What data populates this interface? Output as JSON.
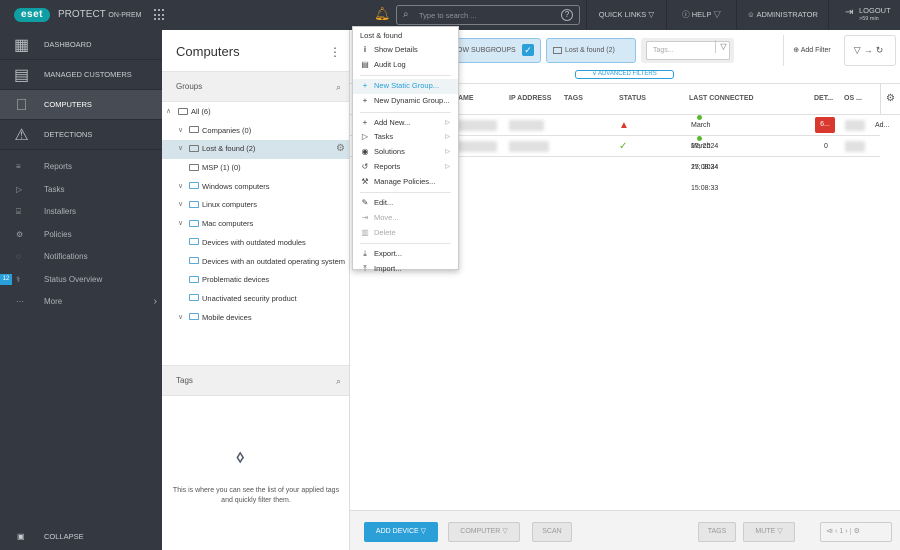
{
  "topbar": {
    "logo": "eset",
    "product": "PROTECT",
    "product_suffix": "ON-PREM",
    "search_placeholder": "Type to search ...",
    "quick_links": "QUICK LINKS",
    "help": "HELP",
    "user": "ADMINISTRATOR",
    "logout": "LOGOUT",
    "logout_timer": ">59 min"
  },
  "sidebar": {
    "main_items": [
      {
        "label": "DASHBOARD",
        "icon": "dashboard-icon"
      },
      {
        "label": "MANAGED CUSTOMERS",
        "icon": "building-icon"
      },
      {
        "label": "COMPUTERS",
        "icon": "computers-icon",
        "active": true
      },
      {
        "label": "DETECTIONS",
        "icon": "warning-icon"
      }
    ],
    "sub_items": [
      {
        "label": "Reports"
      },
      {
        "label": "Tasks"
      },
      {
        "label": "Installers"
      },
      {
        "label": "Policies"
      },
      {
        "label": "Notifications"
      },
      {
        "label": "Status Overview",
        "badge": "12"
      },
      {
        "label": "More"
      }
    ],
    "collapse": "COLLAPSE"
  },
  "groups_panel": {
    "title": "Computers",
    "groups_header": "Groups",
    "tree": [
      {
        "label": "All (6)",
        "level": 0,
        "arrow": "up"
      },
      {
        "label": "Companies (0)",
        "level": 1,
        "arrow": "down"
      },
      {
        "label": "Lost & found (2)",
        "level": 1,
        "arrow": "down",
        "selected": true
      },
      {
        "label": "MSP (1) (0)",
        "level": 2
      },
      {
        "label": "Windows computers",
        "level": 1,
        "arrow": "down"
      },
      {
        "label": "Linux computers",
        "level": 1,
        "arrow": "down"
      },
      {
        "label": "Mac computers",
        "level": 1,
        "arrow": "down"
      },
      {
        "label": "Devices with outdated modules",
        "level": 2
      },
      {
        "label": "Devices with an outdated operating system",
        "level": 2
      },
      {
        "label": "Problematic devices",
        "level": 2
      },
      {
        "label": "Unactivated security product",
        "level": 2
      },
      {
        "label": "Mobile devices",
        "level": 1,
        "arrow": "down"
      }
    ],
    "tags_header": "Tags",
    "tags_empty": "This is where you can see the list of your applied tags and quickly filter them."
  },
  "filters": {
    "show_subgroups": "OW SUBGROUPS",
    "group_chip": "Lost & found  (2)",
    "tags_placeholder": "Tags...",
    "add_filter": "Add Filter",
    "advanced_filters": "ADVANCED FILTERS"
  },
  "table": {
    "columns": [
      "AME",
      "IP ADDRESS",
      "TAGS",
      "STATUS",
      "LAST CONNECTED",
      "DET...",
      "OS ..."
    ],
    "rows": [
      {
        "status": "warning",
        "last_connected": "March 27, 2024 15:08:34",
        "detections": "6...",
        "extra": "Ad..."
      },
      {
        "status": "ok",
        "last_connected": "March 27, 2024 15:08:33",
        "detections": "0",
        "extra": ""
      }
    ]
  },
  "bottom_bar": {
    "add_device": "ADD DEVICE",
    "computer": "COMPUTER",
    "scan": "SCAN",
    "tags": "TAGS",
    "mute": "MUTE",
    "page": "1"
  },
  "context_menu": {
    "header": "Lost & found",
    "items": [
      {
        "label": "Show Details",
        "icon": "info-icon"
      },
      {
        "label": "Audit Log",
        "icon": "clipboard-icon"
      },
      {
        "label": "New Static Group...",
        "icon": "plus-icon",
        "highlighted": true
      },
      {
        "label": "New Dynamic Group...",
        "icon": "plus-icon"
      },
      {
        "label": "Add New...",
        "icon": "plus-icon",
        "submenu": true
      },
      {
        "label": "Tasks",
        "icon": "play-icon",
        "submenu": true
      },
      {
        "label": "Solutions",
        "icon": "solutions-icon",
        "submenu": true
      },
      {
        "label": "Reports",
        "icon": "history-icon",
        "submenu": true
      },
      {
        "label": "Manage Policies...",
        "icon": "wrench-icon"
      },
      {
        "label": "Edit...",
        "icon": "pencil-icon"
      },
      {
        "label": "Move...",
        "icon": "move-icon",
        "disabled": true
      },
      {
        "label": "Delete",
        "icon": "trash-icon",
        "disabled": true
      },
      {
        "label": "Export...",
        "icon": "export-icon"
      },
      {
        "label": "Import...",
        "icon": "import-icon"
      }
    ]
  }
}
